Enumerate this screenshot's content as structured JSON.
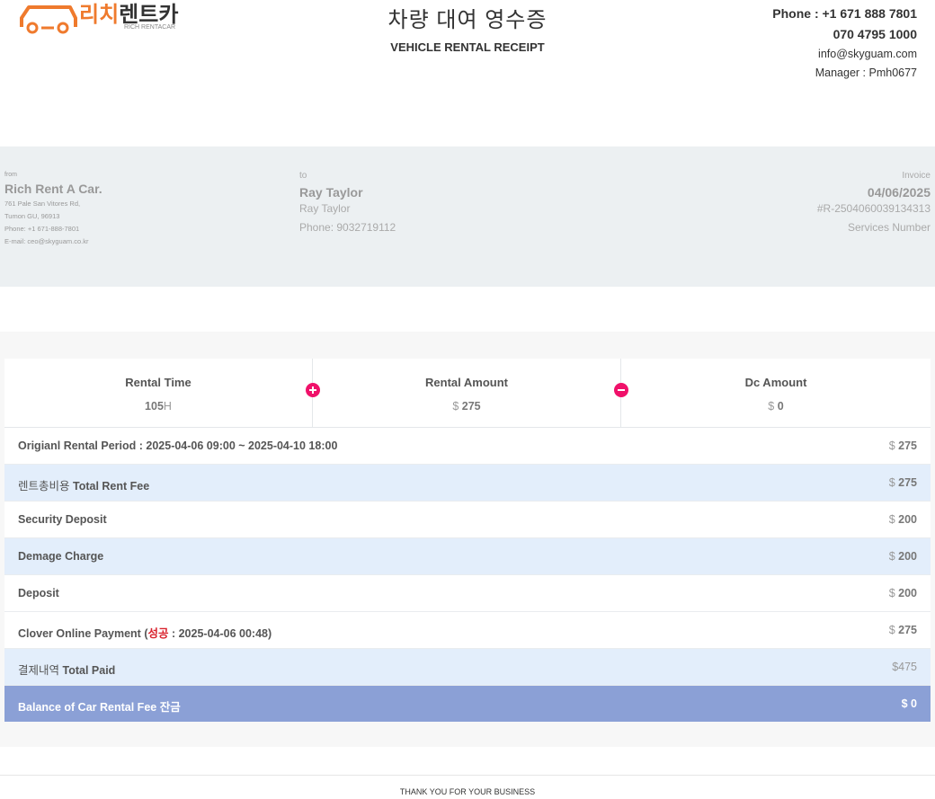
{
  "logo": {
    "brand_ko": "리치렌트카",
    "brand_en": "RICH RENTACAR",
    "accent_color": "#ef7a2d"
  },
  "header": {
    "title_ko": "차량 대여 영수증",
    "title_en": "VEHICLE RENTAL RECEIPT"
  },
  "contact": {
    "phone_line": "Phone : +1 671 888 7801",
    "phone2": "070 4795 1000",
    "email": "info@skyguam.com",
    "manager": "Manager : Pmh0677"
  },
  "from": {
    "label": "from",
    "name": "Rich Rent A Car.",
    "address1": "761 Pale San Vitores Rd,",
    "address2": "Tumon GU, 96913",
    "phone": "Phone: +1 671-888-7801",
    "email": "E-mail: ceo@skyguam.co.kr"
  },
  "to": {
    "label": "to",
    "name": "Ray Taylor",
    "name2": "Ray Taylor",
    "phone": "Phone: 9032719112"
  },
  "invoice": {
    "label": "Invoice",
    "date": "04/06/2025",
    "number": "#R-2504060039134313",
    "services": "Services Number"
  },
  "stats": {
    "rental_time": {
      "label": "Rental Time",
      "value": "105",
      "unit": "H"
    },
    "rental_amount": {
      "label": "Rental Amount",
      "currency": "$",
      "value": "275"
    },
    "dc_amount": {
      "label": "Dc Amount",
      "currency": "$",
      "value": "0"
    },
    "plus_icon": "plus-circle-icon",
    "minus_icon": "minus-circle-icon",
    "icon_color": "#f0116a"
  },
  "rows": {
    "period": {
      "label": "Origianl Rental Period : 2025-04-06 09:00 ~ 2025-04-10 18:00",
      "currency": "$",
      "value": "275"
    },
    "total_rent": {
      "label_ko": "렌트총비용",
      "label": "Total Rent Fee",
      "currency": "$",
      "value": "275"
    },
    "security": {
      "label": "Security Deposit",
      "currency": "$",
      "value": "200"
    },
    "damage": {
      "label": "Demage Charge",
      "currency": "$",
      "value": "200"
    },
    "deposit": {
      "label": "Deposit",
      "currency": "$",
      "value": "200"
    },
    "clover": {
      "label_pre": "Clover Online Payment (",
      "status": "성공",
      "label_post": " : 2025-04-06 00:48)",
      "currency": "$",
      "value": "275"
    },
    "total_paid": {
      "label_ko": "결제내역",
      "label": "Total Paid",
      "amount": "$475"
    },
    "balance": {
      "label": "Balance of Car Rental Fee",
      "label_ko": "잔금",
      "currency": "$",
      "value": "0"
    }
  },
  "footer": {
    "text": "THANK YOU FOR YOUR BUSINESS"
  }
}
